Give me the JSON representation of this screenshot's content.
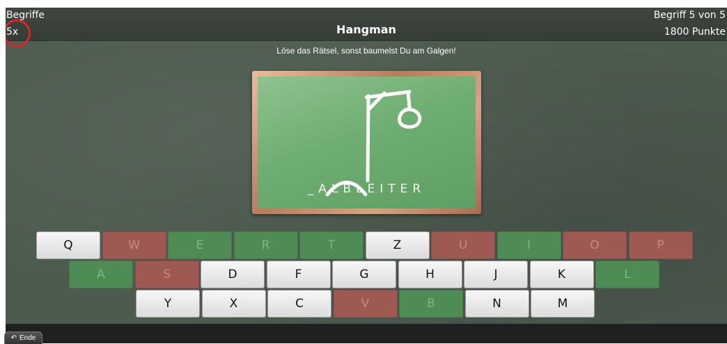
{
  "header": {
    "category": "Begriffe",
    "lives": "5x",
    "title": "Hangman",
    "progress": "Begriff 5 von 5",
    "score": "1800 Punkte"
  },
  "subtitle": "Löse das Rätsel, sonst baumelst Du am Galgen!",
  "puzzle": {
    "display": "_ALBLEITER"
  },
  "keyboard": {
    "row1": [
      {
        "letter": "Q",
        "state": "available"
      },
      {
        "letter": "W",
        "state": "wrong"
      },
      {
        "letter": "E",
        "state": "correct"
      },
      {
        "letter": "R",
        "state": "correct"
      },
      {
        "letter": "T",
        "state": "correct"
      },
      {
        "letter": "Z",
        "state": "available"
      },
      {
        "letter": "U",
        "state": "wrong"
      },
      {
        "letter": "I",
        "state": "correct"
      },
      {
        "letter": "O",
        "state": "wrong"
      },
      {
        "letter": "P",
        "state": "wrong"
      }
    ],
    "row2": [
      {
        "letter": "A",
        "state": "correct"
      },
      {
        "letter": "S",
        "state": "wrong"
      },
      {
        "letter": "D",
        "state": "available"
      },
      {
        "letter": "F",
        "state": "available"
      },
      {
        "letter": "G",
        "state": "available"
      },
      {
        "letter": "H",
        "state": "available"
      },
      {
        "letter": "J",
        "state": "available"
      },
      {
        "letter": "K",
        "state": "available"
      },
      {
        "letter": "L",
        "state": "correct"
      }
    ],
    "row3": [
      {
        "letter": "Y",
        "state": "available"
      },
      {
        "letter": "X",
        "state": "available"
      },
      {
        "letter": "C",
        "state": "available"
      },
      {
        "letter": "V",
        "state": "wrong"
      },
      {
        "letter": "B",
        "state": "correct"
      },
      {
        "letter": "N",
        "state": "available"
      },
      {
        "letter": "M",
        "state": "available"
      }
    ]
  },
  "footer": {
    "exit_label": "Ende",
    "exit_icon": "undo-arrow-icon"
  },
  "colors": {
    "wrong": "#9e5a52",
    "correct": "#4f8c55",
    "available": "#e6e6e6",
    "highlight_circle": "#d9262b"
  }
}
